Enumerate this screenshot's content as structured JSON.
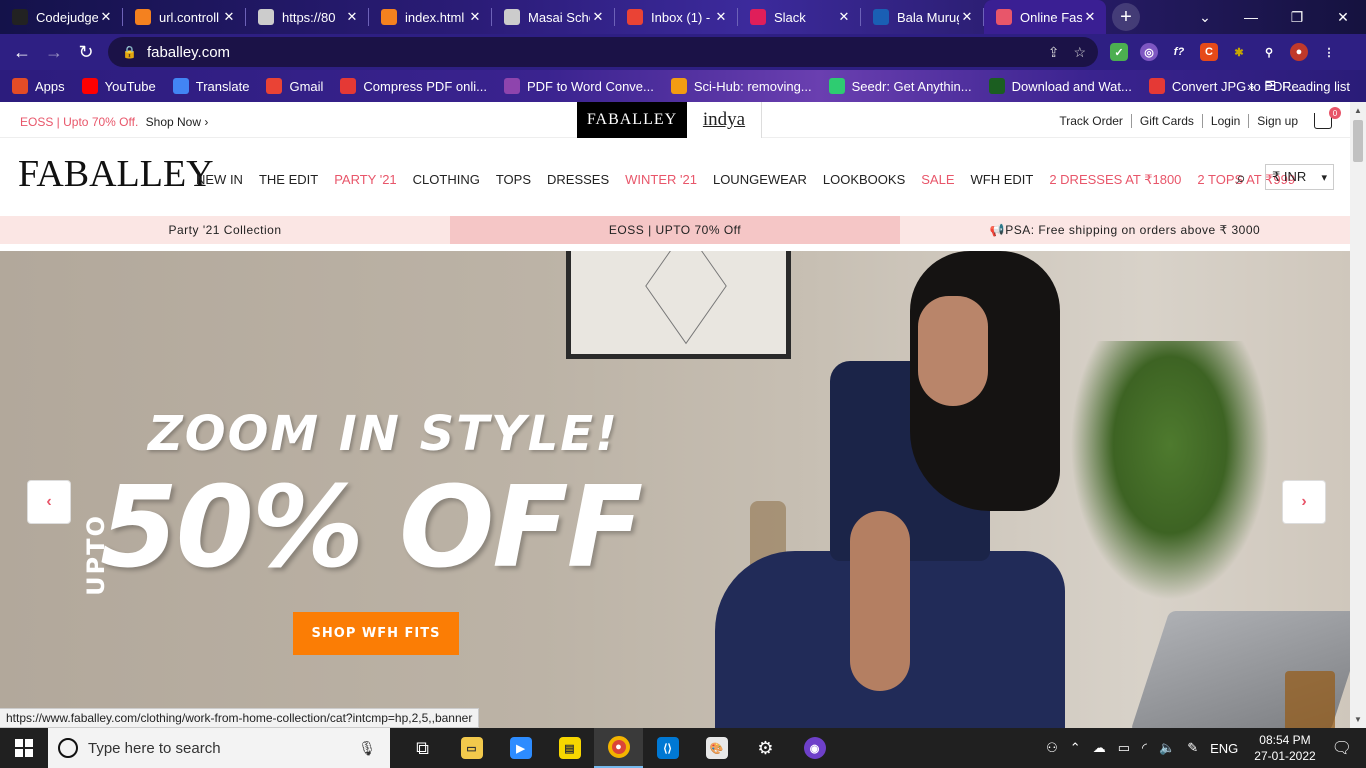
{
  "browser": {
    "tabs": [
      {
        "label": "Codejudge",
        "icon": "codejudge-icon",
        "color": "#222222"
      },
      {
        "label": "url.controll",
        "icon": "g-icon",
        "color": "#f4811f"
      },
      {
        "label": "https://80",
        "icon": "globe-icon",
        "color": "#cccccc"
      },
      {
        "label": "index.html",
        "icon": "g-icon",
        "color": "#f4811f"
      },
      {
        "label": "Masai Scho",
        "icon": "globe-icon",
        "color": "#cccccc"
      },
      {
        "label": "Inbox (1) -",
        "icon": "gmail-icon",
        "color": "#ea4335"
      },
      {
        "label": "Slack",
        "icon": "slack-icon",
        "color": "#e01e5a"
      },
      {
        "label": "Bala Muruga",
        "icon": "bala-icon",
        "color": "#1a5fb4"
      },
      {
        "label": "Online Fas",
        "icon": "faballey-icon",
        "color": "#e8566a",
        "active": true
      }
    ],
    "url": "faballey.com",
    "bookmarks": [
      {
        "label": "Apps",
        "icon": "apps-grid-icon",
        "color": "#e34c26"
      },
      {
        "label": "YouTube",
        "icon": "youtube-icon",
        "color": "#ff0000"
      },
      {
        "label": "Translate",
        "icon": "translate-icon",
        "color": "#4285f4"
      },
      {
        "label": "Gmail",
        "icon": "gmail-icon",
        "color": "#ea4335"
      },
      {
        "label": "Compress PDF onli...",
        "icon": "heart-icon",
        "color": "#e53935"
      },
      {
        "label": "PDF to Word Conve...",
        "icon": "pdf-grid-icon",
        "color": "#8e44ad"
      },
      {
        "label": "Sci-Hub: removing...",
        "icon": "scihub-icon",
        "color": "#f39c12"
      },
      {
        "label": "Seedr: Get Anythin...",
        "icon": "seedr-icon",
        "color": "#2ecc71"
      },
      {
        "label": "Download and Wat...",
        "icon": "tr-icon",
        "color": "#1b5e20"
      },
      {
        "label": "Convert JPG to PDF...",
        "icon": "heart-icon",
        "color": "#e53935"
      }
    ],
    "bookmarks_more": "»",
    "reading_list": "Reading list"
  },
  "site": {
    "promo_text": "EOSS | Upto 70% Off.",
    "promo_link": "Shop Now ›",
    "brand_tab_1": "FABALLEY",
    "brand_tab_2": "indya",
    "top_links": [
      "Track Order",
      "Gift Cards",
      "Login",
      "Sign up"
    ],
    "cart_count": "0",
    "logo": "FABALLEY",
    "menu": [
      {
        "label": "NEW IN",
        "highlight": false
      },
      {
        "label": "THE EDIT",
        "highlight": false
      },
      {
        "label": "PARTY '21",
        "highlight": true
      },
      {
        "label": "CLOTHING",
        "highlight": false
      },
      {
        "label": "TOPS",
        "highlight": false
      },
      {
        "label": "DRESSES",
        "highlight": false
      },
      {
        "label": "WINTER '21",
        "highlight": true
      },
      {
        "label": "LOUNGEWEAR",
        "highlight": false
      },
      {
        "label": "LOOKBOOKS",
        "highlight": false
      },
      {
        "label": "SALE",
        "highlight": true
      },
      {
        "label": "WFH EDIT",
        "highlight": false
      },
      {
        "label": "2 DRESSES AT ₹1800",
        "highlight": true
      },
      {
        "label": "2 TOPS AT ₹999",
        "highlight": true
      }
    ],
    "currency": "₹ INR",
    "ribbon": [
      "Party '21 Collection",
      "EOSS | UPTO 70% Off",
      "📢PSA: Free shipping on orders above ₹ 3000"
    ],
    "hero": {
      "title": "ZOOM IN STYLE!",
      "upto": "UPTO",
      "discount": "50% OFF",
      "cta": "SHOP WFH FITS"
    },
    "accent_color": "#e8566a",
    "cta_color": "#fb7d05"
  },
  "status_url": "https://www.faballey.com/clothing/work-from-home-collection/cat?intcmp=hp,2,5,,banner",
  "taskbar": {
    "search_placeholder": "Type here to search",
    "language": "ENG",
    "time": "08:54 PM",
    "date": "27-01-2022"
  }
}
